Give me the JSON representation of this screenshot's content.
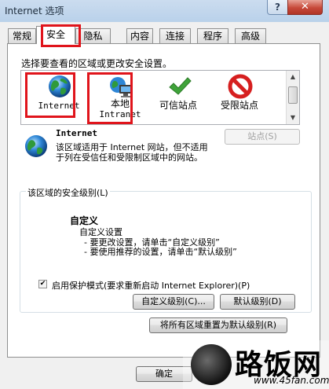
{
  "window": {
    "title": "Internet 选项"
  },
  "tabs": [
    "常规",
    "安全",
    "隐私",
    "内容",
    "连接",
    "程序",
    "高级"
  ],
  "active_tab": "安全",
  "zone_prompt": "选择要查看的区域或更改安全设置。",
  "zones": [
    {
      "label": "Internet",
      "icon": "globe-icon"
    },
    {
      "label": "本地\nIntranet",
      "icon": "local-intranet-icon"
    },
    {
      "label": "可信站点",
      "icon": "trusted-check-icon"
    },
    {
      "label": "受限站点",
      "icon": "restricted-icon"
    }
  ],
  "selected_zone": {
    "title": "Internet",
    "description": "该区域适用于 Internet 网站，但不适用于列在受信任和受限制区域中的网站。",
    "sites_button": "站点(S)"
  },
  "security_level": {
    "group_label": "该区域的安全级别(L)",
    "level_title": "自定义",
    "level_lines": [
      "自定义设置",
      "- 要更改设置，请单击“自定义级别”",
      "- 要使用推荐的设置，请单击“默认级别”"
    ],
    "protected_mode_label": "启用保护模式(要求重新启动 Internet Explorer)(P)",
    "protected_mode_checked": true,
    "custom_level_button": "自定义级别(C)...",
    "default_level_button": "默认级别(D)"
  },
  "reset_all_button": "将所有区域重置为默认级别(R)",
  "ok_button": "确定",
  "watermark": {
    "brand": "路饭网",
    "url": "www.45fan.com"
  },
  "colors": {
    "highlight_red": "#e0141b",
    "title_bar": "#b9d1ea"
  }
}
